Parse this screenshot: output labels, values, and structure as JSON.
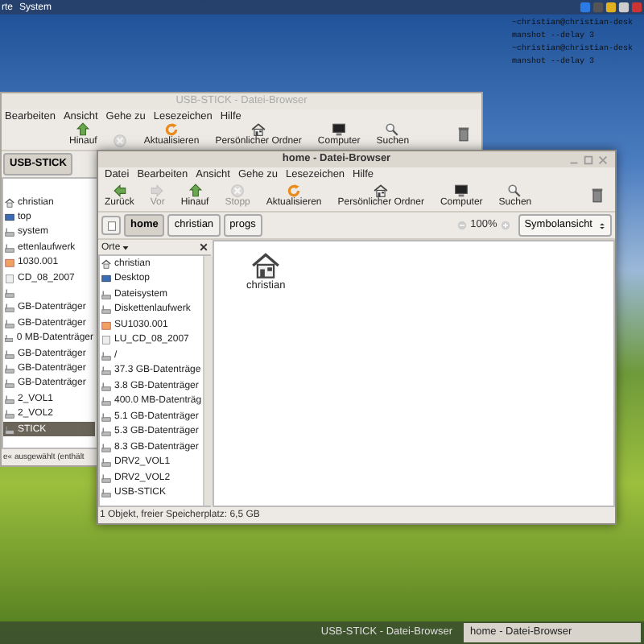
{
  "top_panel": {
    "menus": [
      "rte",
      "System"
    ]
  },
  "terminal": {
    "lines": [
      "~christian@christian-desk",
      "manshot --delay 3",
      "~christian@christian-desk",
      "manshot --delay 3"
    ]
  },
  "back_window": {
    "title": "USB-STICK - Datei-Browser",
    "menu": [
      "Bearbeiten",
      "Ansicht",
      "Gehe zu",
      "Lesezeichen",
      "Hilfe"
    ],
    "toolbar": [
      {
        "kind": "up",
        "label": "Hinauf",
        "disabled": false
      },
      {
        "kind": "stop",
        "disabled": true
      },
      {
        "kind": "reload",
        "label": "Aktualisieren",
        "disabled": false
      },
      {
        "kind": "home",
        "label": "Persönlicher Ordner",
        "disabled": false
      },
      {
        "kind": "computer",
        "label": "Computer",
        "disabled": false
      },
      {
        "kind": "search",
        "label": "Suchen",
        "disabled": false
      }
    ],
    "location": [
      {
        "label": "USB-STICK",
        "selected": true
      }
    ],
    "places": [
      {
        "kind": "home",
        "label": "christian",
        "selected": false
      },
      {
        "kind": "desktop",
        "label": "top",
        "selected": false
      },
      {
        "kind": "drive",
        "label": "system",
        "selected": false
      },
      {
        "kind": "drive",
        "label": "ettenlaufwerk",
        "selected": false
      },
      {
        "kind": "media",
        "label": "1030.001",
        "selected": false
      },
      {
        "kind": "cd",
        "label": "CD_08_2007",
        "selected": false
      },
      {
        "kind": "drive",
        "selected": false
      },
      {
        "kind": "drive",
        "label": "GB-Datenträger",
        "selected": false
      },
      {
        "kind": "drive",
        "label": "GB-Datenträger",
        "selected": false
      },
      {
        "kind": "drive",
        "label": "0 MB-Datenträger",
        "selected": false
      },
      {
        "kind": "drive",
        "label": "GB-Datenträger",
        "selected": false
      },
      {
        "kind": "drive",
        "label": "GB-Datenträger",
        "selected": false
      },
      {
        "kind": "drive",
        "label": "GB-Datenträger",
        "selected": false
      },
      {
        "kind": "drive",
        "label": "2_VOL1",
        "selected": false
      },
      {
        "kind": "drive",
        "label": "2_VOL2",
        "selected": false
      },
      {
        "kind": "drive",
        "label": "STICK",
        "selected": true
      }
    ],
    "status": "e« ausgewählt (enthält"
  },
  "front_window": {
    "title": "home - Datei-Browser",
    "menu": [
      "Datei",
      "Bearbeiten",
      "Ansicht",
      "Gehe zu",
      "Lesezeichen",
      "Hilfe"
    ],
    "toolbar": [
      {
        "kind": "back",
        "label": "Zurück",
        "disabled": false
      },
      {
        "kind": "forward",
        "label": "Vor",
        "disabled": true
      },
      {
        "kind": "up",
        "label": "Hinauf",
        "disabled": false
      },
      {
        "kind": "stop",
        "label": "Stopp",
        "disabled": true
      },
      {
        "kind": "reload",
        "label": "Aktualisieren",
        "disabled": false
      },
      {
        "kind": "home",
        "label": "Persönlicher Ordner",
        "disabled": false
      },
      {
        "kind": "computer",
        "label": "Computer",
        "disabled": false
      },
      {
        "kind": "search",
        "label": "Suchen",
        "disabled": false
      }
    ],
    "location": [
      {
        "label": "home",
        "selected": true
      },
      {
        "label": "christian",
        "selected": false
      },
      {
        "label": "progs",
        "selected": false
      }
    ],
    "zoom": "100%",
    "view": "Symbolansicht",
    "sidebar_title": "Orte",
    "places": [
      {
        "kind": "home",
        "label": "christian",
        "selected": false
      },
      {
        "kind": "desktop",
        "label": "Desktop",
        "selected": false
      },
      {
        "kind": "drive",
        "label": "Dateisystem",
        "selected": false
      },
      {
        "kind": "drive",
        "label": "Diskettenlaufwerk",
        "selected": false
      },
      {
        "kind": "media",
        "label": "SU1030.001",
        "selected": false
      },
      {
        "kind": "cd",
        "label": "LU_CD_08_2007",
        "selected": false
      },
      {
        "kind": "drive",
        "label": "/",
        "selected": false
      },
      {
        "kind": "drive",
        "label": "37.3 GB-Datenträge",
        "selected": false
      },
      {
        "kind": "drive",
        "label": "3.8 GB-Datenträger",
        "selected": false
      },
      {
        "kind": "drive",
        "label": "400.0 MB-Datenträg",
        "selected": false
      },
      {
        "kind": "drive",
        "label": "5.1 GB-Datenträger",
        "selected": false
      },
      {
        "kind": "drive",
        "label": "5.3 GB-Datenträger",
        "selected": false
      },
      {
        "kind": "drive",
        "label": "8.3 GB-Datenträger",
        "selected": false
      },
      {
        "kind": "drive",
        "label": "DRV2_VOL1",
        "selected": false
      },
      {
        "kind": "drive",
        "label": "DRV2_VOL2",
        "selected": false
      },
      {
        "kind": "drive",
        "label": "USB-STICK",
        "selected": false
      }
    ],
    "files": [
      {
        "kind": "home",
        "label": "christian"
      }
    ],
    "status": "1 Objekt, freier Speicherplatz: 6,5 GB"
  },
  "taskbar": [
    {
      "label": "USB-STICK - Datei-Browser",
      "selected": false
    },
    {
      "label": "home - Datei-Browser",
      "selected": true
    }
  ]
}
